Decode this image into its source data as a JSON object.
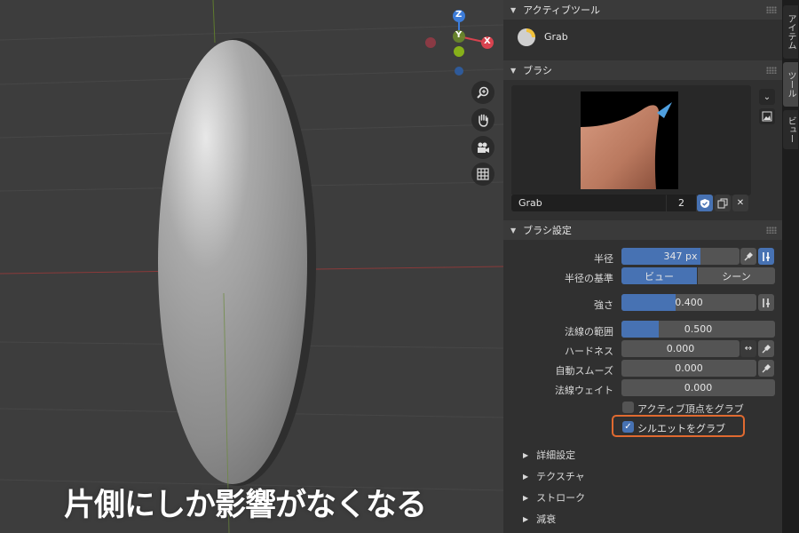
{
  "caption": "片側にしか影響がなくなる",
  "gizmo": {
    "z_label": "Z",
    "y_label": "Y",
    "x_label": "X"
  },
  "nav_icons": [
    "zoom-icon",
    "hand-pan-icon",
    "camera-icon",
    "grid-icon"
  ],
  "tabs": [
    "アイテム",
    "ツール",
    "ビュー"
  ],
  "active_tool": {
    "header": "アクティブツール",
    "name": "Grab"
  },
  "brush": {
    "header": "ブラシ",
    "name": "Grab",
    "users": "2"
  },
  "brush_settings": {
    "header": "ブラシ設定",
    "radius": {
      "label": "半径",
      "value": "347 px"
    },
    "radius_base": {
      "label": "半径の基準",
      "options": [
        "ビュー",
        "シーン"
      ],
      "selected": "ビュー"
    },
    "strength": {
      "label": "強さ",
      "value": "0.400",
      "fraction": 0.4
    },
    "normal_radius": {
      "label": "法線の範囲",
      "value": "0.500",
      "fraction": 0.5
    },
    "hardness": {
      "label": "ハードネス",
      "value": "0.000"
    },
    "auto_smooth": {
      "label": "自動スムーズ",
      "value": "0.000"
    },
    "normal_weight": {
      "label": "法線ウェイト",
      "value": "0.000"
    },
    "grab_active_vertex": {
      "label": "アクティブ頂点をグラブ",
      "checked": false
    },
    "grab_silhouette": {
      "label": "シルエットをグラブ",
      "checked": true
    }
  },
  "subpanels": [
    "詳細設定",
    "テクスチャ",
    "ストローク",
    "減衰"
  ],
  "colors": {
    "accent": "#4772b3",
    "highlight_box": "#e06a30"
  }
}
